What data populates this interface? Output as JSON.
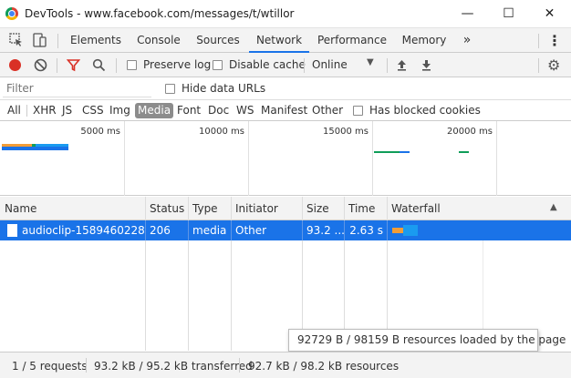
{
  "window": {
    "title": "DevTools - www.facebook.com/messages/t/wtillor",
    "minimize": "—",
    "maximize": "☐",
    "close": "✕"
  },
  "tabs": [
    {
      "label": "Elements",
      "active": false
    },
    {
      "label": "Console",
      "active": false
    },
    {
      "label": "Sources",
      "active": false
    },
    {
      "label": "Network",
      "active": true
    },
    {
      "label": "Performance",
      "active": false
    },
    {
      "label": "Memory",
      "active": false
    }
  ],
  "tabs_overflow": "»",
  "toolbar": {
    "preserve_log": "Preserve log",
    "disable_cache": "Disable cache",
    "throttle": "Online",
    "record_color": "#d93025"
  },
  "filter": {
    "placeholder": "Filter",
    "hide_data_urls": "Hide data URLs"
  },
  "filter_types": [
    "All",
    "XHR",
    "JS",
    "CSS",
    "Img",
    "Media",
    "Font",
    "Doc",
    "WS",
    "Manifest",
    "Other"
  ],
  "selected_type": "Media",
  "has_blocked_cookies": "Has blocked cookies",
  "overview": {
    "ticks": [
      "5000 ms",
      "10000 ms",
      "15000 ms",
      "20000 ms"
    ]
  },
  "table": {
    "columns": [
      "Name",
      "Status",
      "Type",
      "Initiator",
      "Size",
      "Time",
      "Waterfall"
    ],
    "rows": [
      {
        "name": "audioclip-1589460228...",
        "status": "206",
        "type": "media",
        "initiator": "Other",
        "size": "93.2 ...",
        "time": "2.63 s"
      }
    ]
  },
  "tooltip": "92729 B / 98159 B resources loaded by the page",
  "status": {
    "requests": "1 / 5 requests",
    "transferred": "93.2 kB / 95.2 kB transferred",
    "resources": "92.7 kB / 98.2 kB resources"
  }
}
